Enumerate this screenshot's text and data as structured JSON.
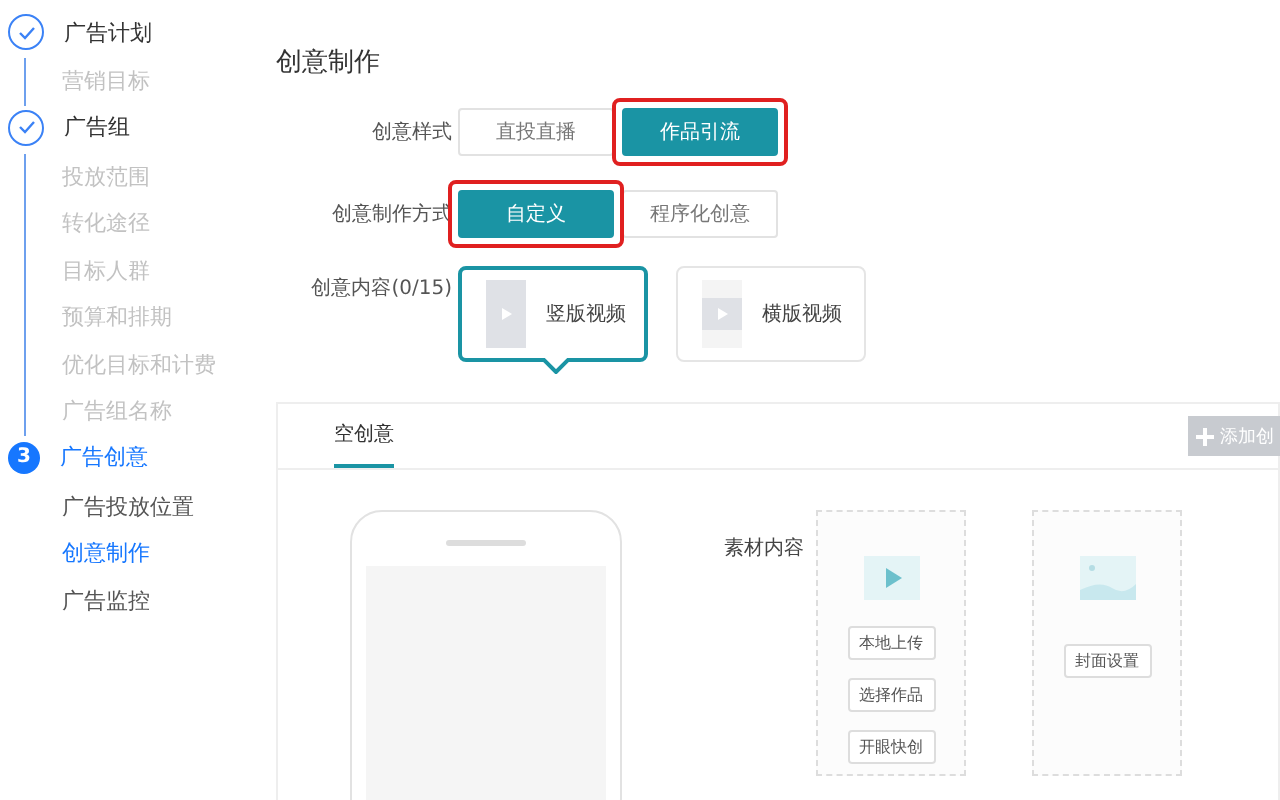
{
  "sidebar": {
    "steps": [
      {
        "done": true,
        "current": false,
        "title": "广告计划",
        "items": [
          {
            "label": "营销目标",
            "disabled": true,
            "selected": false
          }
        ]
      },
      {
        "done": true,
        "current": false,
        "title": "广告组",
        "items": [
          {
            "label": "投放范围",
            "disabled": true,
            "selected": false
          },
          {
            "label": "转化途径",
            "disabled": true,
            "selected": false
          },
          {
            "label": "目标人群",
            "disabled": true,
            "selected": false
          },
          {
            "label": "预算和排期",
            "disabled": true,
            "selected": false
          },
          {
            "label": "优化目标和计费",
            "disabled": true,
            "selected": false
          },
          {
            "label": "广告组名称",
            "disabled": true,
            "selected": false
          }
        ]
      },
      {
        "marker": "3",
        "done": false,
        "current": true,
        "title": "广告创意",
        "items": [
          {
            "label": "广告投放位置",
            "disabled": false,
            "selected": false
          },
          {
            "label": "创意制作",
            "disabled": false,
            "selected": true
          },
          {
            "label": "广告监控",
            "disabled": false,
            "selected": false
          }
        ]
      }
    ]
  },
  "main": {
    "title": "创意制作",
    "style_row": {
      "label": "创意样式",
      "options": [
        {
          "label": "直投直播",
          "selected": false,
          "highlighted": false
        },
        {
          "label": "作品引流",
          "selected": true,
          "highlighted": true
        }
      ]
    },
    "method_row": {
      "label": "创意制作方式",
      "options": [
        {
          "label": "自定义",
          "selected": true,
          "highlighted": true
        },
        {
          "label": "程序化创意",
          "selected": false,
          "highlighted": false
        }
      ]
    },
    "content_row": {
      "label": "创意内容(0/15)",
      "cards": [
        {
          "label": "竖版视频",
          "kind": "portrait",
          "selected": true
        },
        {
          "label": "横版视频",
          "kind": "landscape",
          "selected": false
        }
      ]
    },
    "panel": {
      "tabs": [
        {
          "label": "空创意",
          "selected": true
        }
      ],
      "add_button": "添加创",
      "material_label": "素材内容",
      "video_box": {
        "buttons": [
          "本地上传",
          "选择作品",
          "开眼快创"
        ]
      },
      "cover_box": {
        "buttons": [
          "封面设置"
        ]
      }
    }
  }
}
